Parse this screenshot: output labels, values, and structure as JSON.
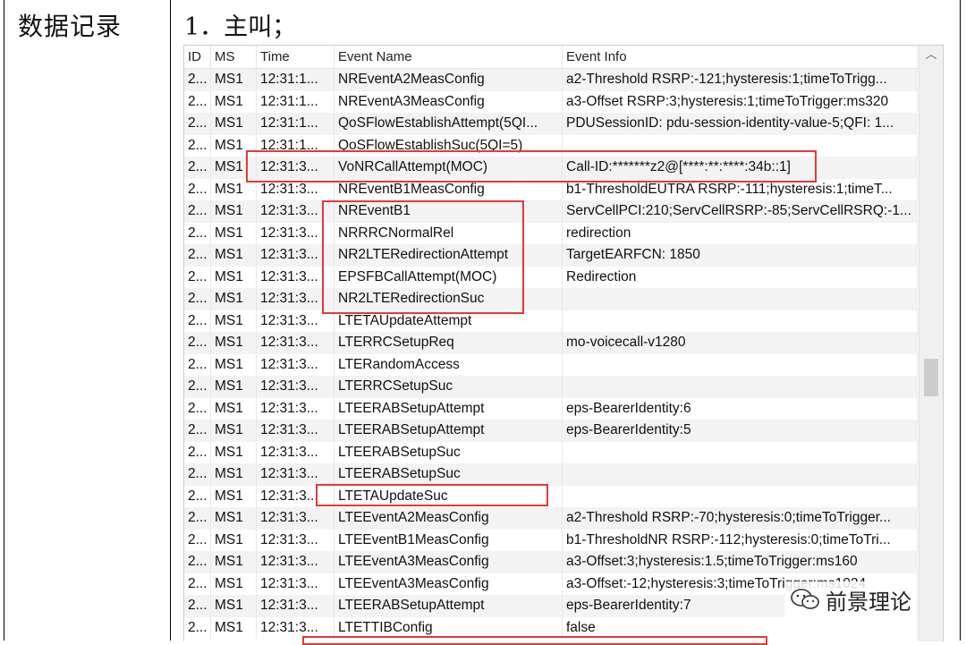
{
  "left_label": "数据记录",
  "section_title": "1．主叫；",
  "grid": {
    "columns": [
      "ID",
      "MS",
      "Time",
      "Event Name",
      "Event Info"
    ],
    "rows": [
      [
        "2...",
        "MS1",
        "12:31:1...",
        "NREventA2MeasConfig",
        "a2-Threshold RSRP:-121;hysteresis:1;timeToTrigg..."
      ],
      [
        "2...",
        "MS1",
        "12:31:1...",
        "NREventA3MeasConfig",
        "a3-Offset RSRP:3;hysteresis:1;timeToTrigger:ms320"
      ],
      [
        "2...",
        "MS1",
        "12:31:1...",
        "QoSFlowEstablishAttempt(5QI...",
        "PDUSessionID: pdu-session-identity-value-5;QFI: 1..."
      ],
      [
        "2...",
        "MS1",
        "12:31:1...",
        "QoSFlowEstablishSuc(5QI=5)",
        ""
      ],
      [
        "2...",
        "MS1",
        "12:31:3...",
        "VoNRCallAttempt(MOC)",
        "Call-ID:*******z2@[****:**:****:34b::1]"
      ],
      [
        "2...",
        "MS1",
        "12:31:3...",
        "NREventB1MeasConfig",
        "b1-ThresholdEUTRA RSRP:-111;hysteresis:1;timeT..."
      ],
      [
        "2...",
        "MS1",
        "12:31:3...",
        "NREventB1",
        "ServCellPCI:210;ServCellRSRP:-85;ServCellRSRQ:-1..."
      ],
      [
        "2...",
        "MS1",
        "12:31:3...",
        "NRRRCNormalRel",
        "redirection"
      ],
      [
        "2...",
        "MS1",
        "12:31:3...",
        "NR2LTERedirectionAttempt",
        "TargetEARFCN: 1850"
      ],
      [
        "2...",
        "MS1",
        "12:31:3...",
        "EPSFBCallAttempt(MOC)",
        "Redirection"
      ],
      [
        "2...",
        "MS1",
        "12:31:3...",
        "NR2LTERedirectionSuc",
        ""
      ],
      [
        "2...",
        "MS1",
        "12:31:3...",
        "LTETAUpdateAttempt",
        ""
      ],
      [
        "2...",
        "MS1",
        "12:31:3...",
        "LTERRCSetupReq",
        "mo-voicecall-v1280"
      ],
      [
        "2...",
        "MS1",
        "12:31:3...",
        "LTERandomAccess",
        ""
      ],
      [
        "2...",
        "MS1",
        "12:31:3...",
        "LTERRCSetupSuc",
        ""
      ],
      [
        "2...",
        "MS1",
        "12:31:3...",
        "LTEERABSetupAttempt",
        "eps-BearerIdentity:6"
      ],
      [
        "2...",
        "MS1",
        "12:31:3...",
        "LTEERABSetupAttempt",
        "eps-BearerIdentity:5"
      ],
      [
        "2...",
        "MS1",
        "12:31:3...",
        "LTEERABSetupSuc",
        ""
      ],
      [
        "2...",
        "MS1",
        "12:31:3...",
        "LTEERABSetupSuc",
        ""
      ],
      [
        "2...",
        "MS1",
        "12:31:3...",
        "LTETAUpdateSuc",
        ""
      ],
      [
        "2...",
        "MS1",
        "12:31:3...",
        "LTEEventA2MeasConfig",
        "a2-Threshold RSRP:-70;hysteresis:0;timeToTrigger..."
      ],
      [
        "2...",
        "MS1",
        "12:31:3...",
        "LTEEventB1MeasConfig",
        "b1-ThresholdNR RSRP:-112;hysteresis:0;timeToTri..."
      ],
      [
        "2...",
        "MS1",
        "12:31:3...",
        "LTEEventA3MeasConfig",
        "a3-Offset:3;hysteresis:1.5;timeToTrigger:ms160"
      ],
      [
        "2...",
        "MS1",
        "12:31:3...",
        "LTEEventA3MeasConfig",
        "a3-Offset:-12;hysteresis:3;timeToTrigger:ms1024"
      ],
      [
        "2...",
        "MS1",
        "12:31:3...",
        "LTEERABSetupAttempt",
        "eps-BearerIdentity:7"
      ],
      [
        "2...",
        "MS1",
        "12:31:3...",
        "LTETTIBConfig",
        "false"
      ]
    ]
  },
  "highlight_color": "#e53935",
  "watermark": {
    "text": "前景理论",
    "icon": "wechat-icon"
  }
}
